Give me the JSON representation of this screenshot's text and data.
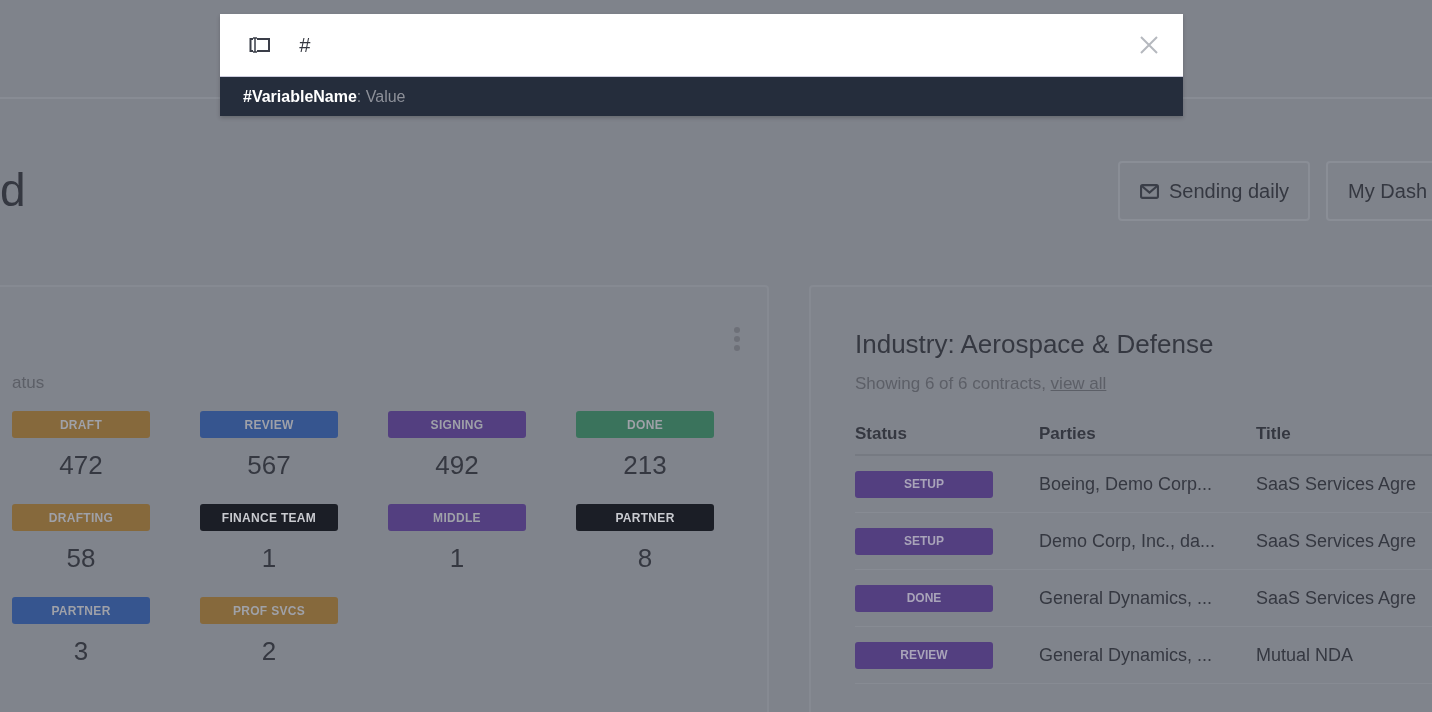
{
  "search": {
    "value": "#",
    "suggestion": "**#VariableName**: Value"
  },
  "page_title": "d",
  "header_buttons": [
    {
      "label": "Sending daily",
      "kind": "icon"
    },
    {
      "label": "My Dash",
      "kind": "plain"
    }
  ],
  "status_card": {
    "subtitle": "atus",
    "tiles": [
      {
        "tag": "DRAFT",
        "count": "472",
        "color": "#86693c"
      },
      {
        "tag": "REVIEW",
        "count": "567",
        "color": "#36558f"
      },
      {
        "tag": "SIGNING",
        "count": "492",
        "color": "#533f80"
      },
      {
        "tag": "DONE",
        "count": "213",
        "color": "#3a735c"
      },
      {
        "tag": "DRAFTING",
        "count": "58",
        "color": "#86693c"
      },
      {
        "tag": "FINANCE TEAM",
        "count": "1",
        "color": "#1b1e26"
      },
      {
        "tag": "MIDDLE",
        "count": "1",
        "color": "#533f80"
      },
      {
        "tag": "PARTNER",
        "count": "8",
        "color": "#1b1e26"
      },
      {
        "tag": "PARTNER",
        "count": "3",
        "color": "#36558f"
      },
      {
        "tag": "PROF SVCS",
        "count": "2",
        "color": "#86693c"
      }
    ]
  },
  "contracts_card": {
    "title": "Industry: Aerospace & Defense",
    "summary": "Showing 6 of 6 contracts, ",
    "summary_link": "view all",
    "table": {
      "columns": [
        "Status",
        "Parties",
        "Title"
      ],
      "rows": [
        {
          "status": "SETUP",
          "parties": "Boeing, Demo Corp...",
          "title": "SaaS Services Agre"
        },
        {
          "status": "SETUP",
          "parties": "Demo Corp, Inc., da...",
          "title": "SaaS Services Agre"
        },
        {
          "status": "DONE",
          "parties": "General Dynamics, ...",
          "title": "SaaS Services Agre"
        },
        {
          "status": "REVIEW",
          "parties": "General Dynamics, ...",
          "title": "Mutual NDA"
        }
      ]
    }
  }
}
